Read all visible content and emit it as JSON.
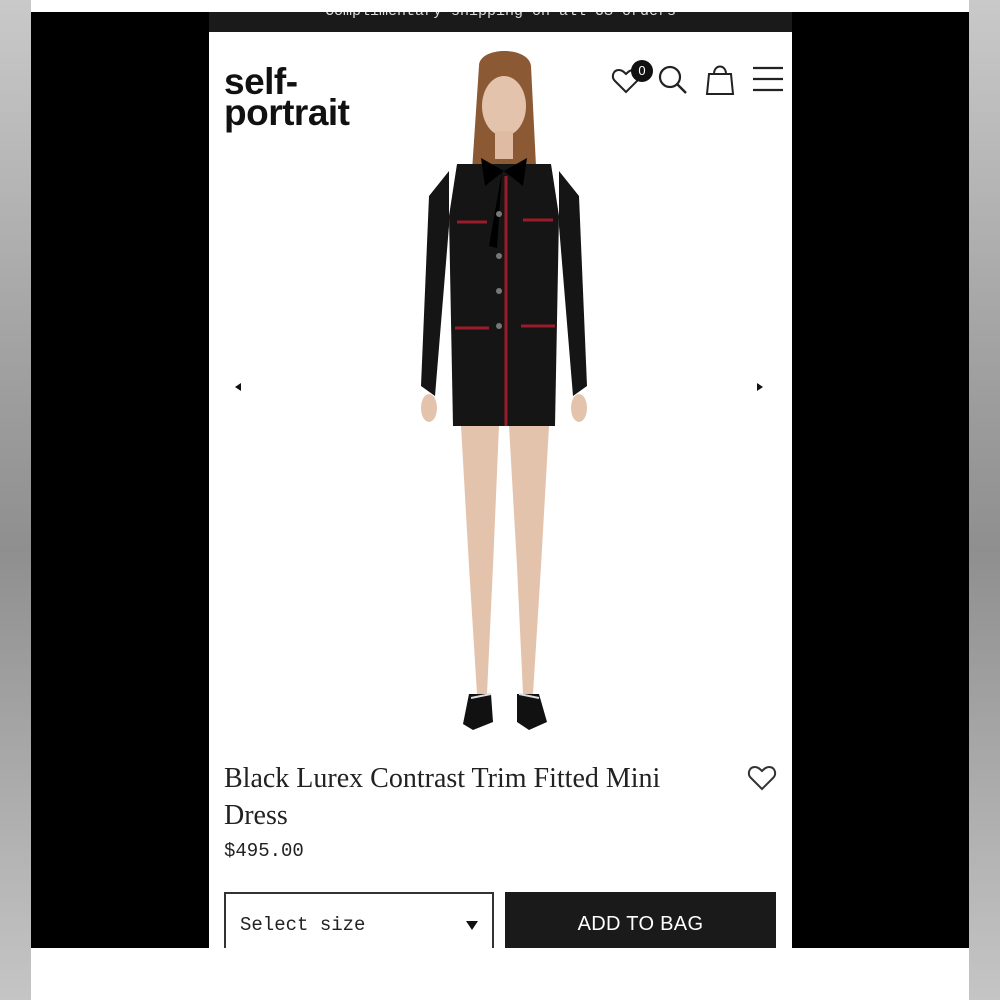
{
  "promo": {
    "text": "Complimentary shipping on all US orders"
  },
  "brand": {
    "line1": "self-",
    "line2": "portrait"
  },
  "header": {
    "wishlist_count": "0"
  },
  "product": {
    "title": "Black Lurex Contrast Trim Fitted Mini Dress",
    "price": "$495.00",
    "size_placeholder": "Select size",
    "add_to_bag": "ADD TO BAG"
  },
  "colors": {
    "accent": "#1a1a1a",
    "trim_red": "#9a1c2a",
    "background": "#ffffff"
  },
  "icons": [
    "heart-icon",
    "search-icon",
    "bag-icon",
    "menu-icon",
    "arrow-left-icon",
    "arrow-right-icon",
    "caret-down-icon"
  ]
}
